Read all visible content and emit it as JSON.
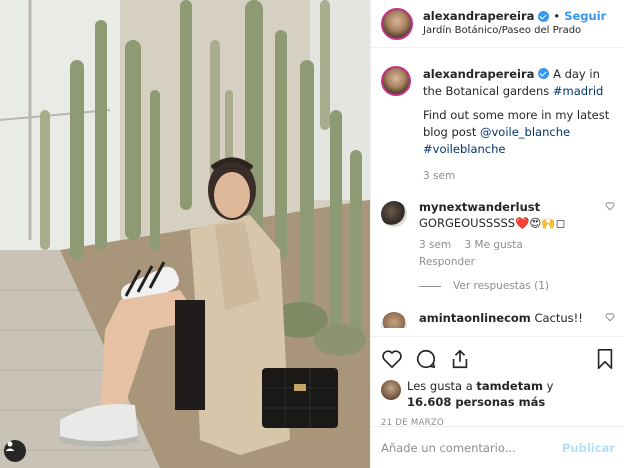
{
  "post": {
    "author": "alexandrapereira",
    "follow_separator": "•",
    "follow_label": "Seguir",
    "location": "Jardín Botánico/Paseo del Prado"
  },
  "caption": {
    "username": "alexandrapereira",
    "text": "A day in the Botanical gardens",
    "hashtag": "#madrid"
  },
  "comments": [
    {
      "username": "alexandrapereira",
      "text": "Find out some more in my latest blog post",
      "mention": "@voile_blanche",
      "hashtag": "#voileblanche",
      "time": "3 sem"
    },
    {
      "username": "mynextwanderlust",
      "text": "GORGEOUSSSSS❤️😍🙌◻",
      "time": "3 sem",
      "likes": "3 Me gusta",
      "reply_label": "Responder",
      "view_replies": "Ver respuestas (1)"
    },
    {
      "username": "amintaonlinecom",
      "text": "Cactus!! Tus favos"
    }
  ],
  "likes": {
    "prefix": "Les gusta a",
    "liker": "tamdetam",
    "conjunction": "y",
    "count": "16.608 personas más"
  },
  "date": "21 DE MARZO",
  "composer": {
    "placeholder": "Añade un comentario...",
    "post_label": "Publicar"
  },
  "colors": {
    "accent": "#3897f0",
    "text": "#262626",
    "muted": "#8e8e8e",
    "post_disabled": "#b2dffc"
  }
}
